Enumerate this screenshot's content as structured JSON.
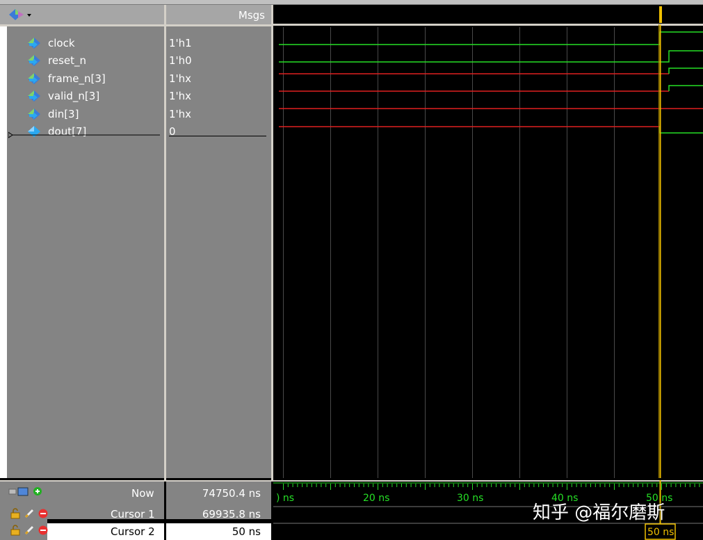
{
  "header": {
    "msgs_label": "Msgs"
  },
  "signals": [
    {
      "name": "clock",
      "value": "1'h1"
    },
    {
      "name": "reset_n",
      "value": "1'h0"
    },
    {
      "name": "frame_n[3]",
      "value": "1'hx"
    },
    {
      "name": "valid_n[3]",
      "value": "1'hx"
    },
    {
      "name": "din[3]",
      "value": "1'hx"
    },
    {
      "name": "dout[7]",
      "value": "0"
    }
  ],
  "cursors": {
    "now": {
      "label": "Now",
      "value": "74750.4 ns"
    },
    "cursor1": {
      "label": "Cursor 1",
      "value": "69935.8 ns"
    },
    "cursor2": {
      "label": "Cursor 2",
      "value": "50 ns",
      "marker": "50 ns"
    }
  },
  "timeline": {
    "labels": [
      ") ns",
      "20 ns",
      "30 ns",
      "40 ns",
      "50 ns"
    ]
  },
  "watermark": "知乎 @福尔磨斯",
  "colors": {
    "wave_high": "#26e026",
    "wave_unknown": "#e02020",
    "cursor": "#f0c000",
    "grid": "#4a4a4a"
  },
  "icons": {
    "signal": "diamond-arrow-icon",
    "dout": "diamond-icon",
    "toolbar": "wave-toolbar-icon",
    "lock": "lock-icon",
    "pencil": "pencil-icon",
    "delete": "delete-icon",
    "add": "add-cursor-icon"
  }
}
